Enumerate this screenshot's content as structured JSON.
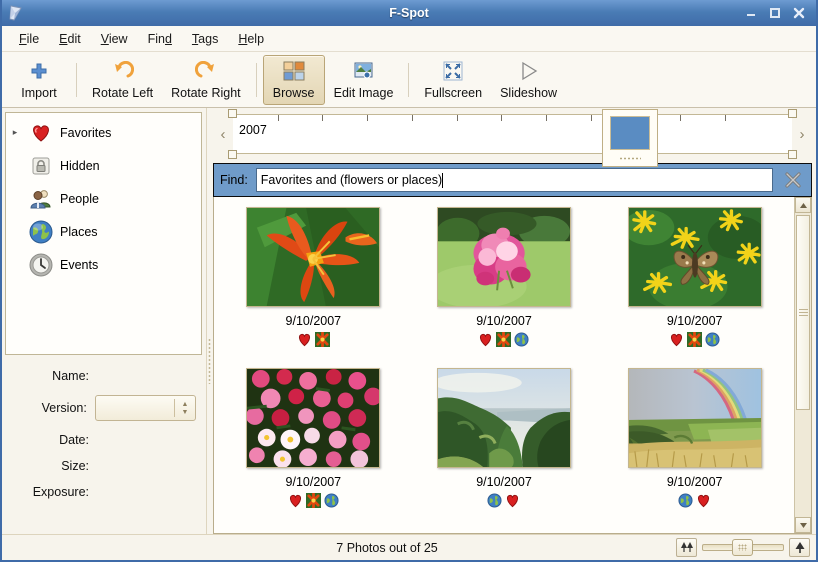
{
  "window": {
    "title": "F-Spot",
    "icon": "fspot-logo-icon",
    "minimize_label": "–",
    "maximize_label": "□",
    "close_label": "✕"
  },
  "menubar": {
    "items": [
      {
        "label": "File",
        "mnemonic": "F"
      },
      {
        "label": "Edit",
        "mnemonic": "E"
      },
      {
        "label": "View",
        "mnemonic": "V"
      },
      {
        "label": "Find",
        "mnemonic": "d"
      },
      {
        "label": "Tags",
        "mnemonic": "T"
      },
      {
        "label": "Help",
        "mnemonic": "H"
      }
    ]
  },
  "toolbar": {
    "items": [
      {
        "label": "Import",
        "icon": "plus-icon",
        "active": false
      },
      {
        "label": "Rotate Left",
        "icon": "rotate-left-icon",
        "active": false
      },
      {
        "label": "Rotate Right",
        "icon": "rotate-right-icon",
        "active": false
      },
      {
        "label": "Browse",
        "icon": "browse-grid-icon",
        "active": true
      },
      {
        "label": "Edit Image",
        "icon": "edit-image-icon",
        "active": false
      },
      {
        "label": "Fullscreen",
        "icon": "fullscreen-icon",
        "active": false
      },
      {
        "label": "Slideshow",
        "icon": "slideshow-play-icon",
        "active": false
      }
    ]
  },
  "sidebar": {
    "tags": [
      {
        "label": "Favorites",
        "icon": "heart-icon",
        "expander": true
      },
      {
        "label": "Hidden",
        "icon": "padlock-icon",
        "expander": false
      },
      {
        "label": "People",
        "icon": "people-icon",
        "expander": false
      },
      {
        "label": "Places",
        "icon": "globe-icon",
        "expander": false
      },
      {
        "label": "Events",
        "icon": "clock-icon",
        "expander": false
      }
    ],
    "metadata": {
      "name_label": "Name:",
      "name_value": "",
      "version_label": "Version:",
      "version_value": "",
      "date_label": "Date:",
      "date_value": "",
      "size_label": "Size:",
      "size_value": "",
      "exposure_label": "Exposure:",
      "exposure_value": ""
    }
  },
  "timeline": {
    "year_label": "2007",
    "prev_arrow": "‹",
    "next_arrow": "›",
    "selected_bar_color": "#5a8cc2"
  },
  "find": {
    "label": "Find:",
    "query": "Favorites and (flowers or places)",
    "placeholder": "",
    "close_icon": "close-x-icon"
  },
  "photos": [
    {
      "caption": "9/10/2007",
      "image": "orange-daylily-flower",
      "badges": [
        "heart-icon",
        "flower-tag-icon"
      ]
    },
    {
      "caption": "9/10/2007",
      "image": "pink-crepe-myrtle-shrub",
      "badges": [
        "heart-icon",
        "flower-tag-icon",
        "globe-icon"
      ]
    },
    {
      "caption": "9/10/2007",
      "image": "butterfly-on-yellow-flowers",
      "badges": [
        "heart-icon",
        "flower-tag-icon",
        "globe-icon"
      ]
    },
    {
      "caption": "9/10/2007",
      "image": "pink-white-flower-bed",
      "badges": [
        "heart-icon",
        "flower-tag-icon",
        "globe-icon"
      ]
    },
    {
      "caption": "9/10/2007",
      "image": "green-valley-coastline",
      "badges": [
        "globe-icon",
        "heart-icon"
      ]
    },
    {
      "caption": "9/10/2007",
      "image": "rainbow-over-fields",
      "badges": [
        "globe-icon",
        "heart-icon"
      ]
    }
  ],
  "statusbar": {
    "text": "7 Photos out of 25",
    "zoom_out_icon": "two-trees-icon",
    "zoom_in_icon": "one-tree-icon",
    "zoom_slider_value": 38
  },
  "colors": {
    "titlebar": "#3f6ba8",
    "findbar": "#6f9bc9",
    "toolbar_active": "#e3d6b4",
    "panel": "#f7f4ec"
  }
}
